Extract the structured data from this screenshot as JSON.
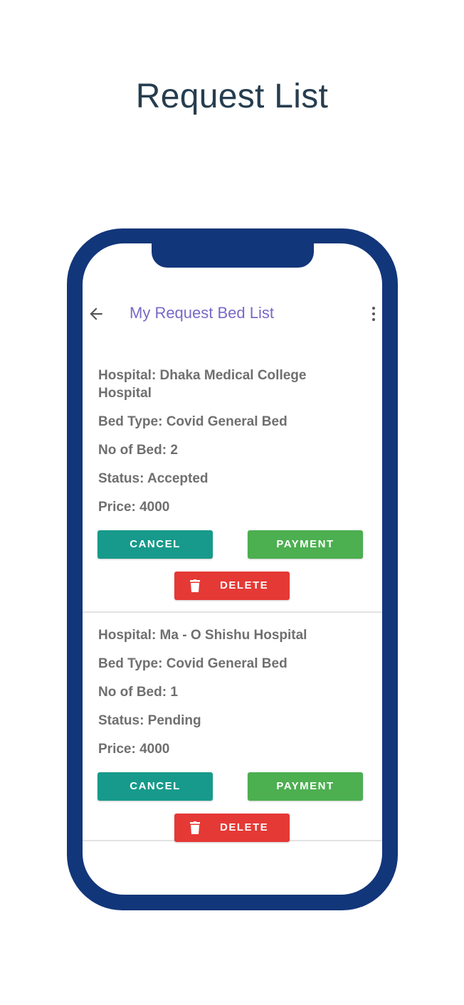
{
  "page_title": "Request List",
  "app_bar": {
    "title": "My Request Bed List",
    "back_icon": "arrow-left-icon",
    "menu_icon": "more-vertical-icon"
  },
  "requests": [
    {
      "hospital": "Hospital: Dhaka Medical College Hospital",
      "bed_type": "Bed Type: Covid General Bed",
      "no_of_bed": "No of Bed: 2",
      "status": "Status: Accepted",
      "price": "Price: 4000",
      "cancel_label": "CANCEL",
      "payment_label": "PAYMENT",
      "delete_label": "DELETE"
    },
    {
      "hospital": "Hospital: Ma - O Shishu Hospital",
      "bed_type": "Bed Type: Covid General Bed",
      "no_of_bed": "No of Bed: 1",
      "status": "Status: Pending",
      "price": "Price: 4000",
      "cancel_label": "CANCEL",
      "payment_label": "PAYMENT",
      "delete_label": "DELETE"
    }
  ],
  "colors": {
    "frame": "#12367a",
    "title_text": "#263d4f",
    "app_title": "#7a68c6",
    "cancel": "#179a8b",
    "payment": "#4caf50",
    "delete": "#e53935"
  }
}
